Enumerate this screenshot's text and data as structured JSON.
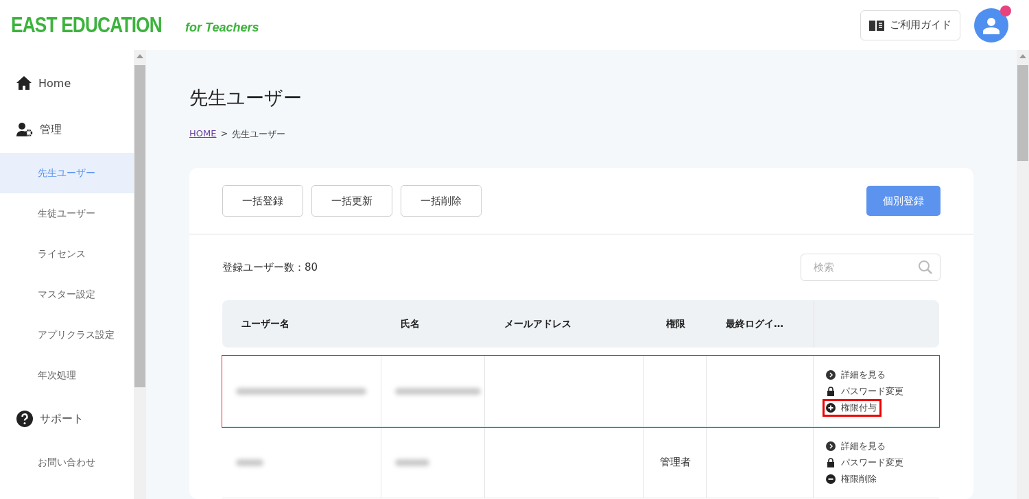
{
  "header": {
    "logo": "EAST EDUCATION",
    "logo_sub": "for Teachers",
    "guide_button": "ご利用ガイド",
    "notification": true
  },
  "sidebar": {
    "items": [
      {
        "label": "Home",
        "kind": "home",
        "selected": false
      },
      {
        "label": "管理",
        "kind": "admin",
        "selected": false,
        "children": [
          {
            "label": "先生ユーザー",
            "selected": true
          },
          {
            "label": "生徒ユーザー",
            "selected": false
          },
          {
            "label": "ライセンス",
            "selected": false
          },
          {
            "label": "マスター設定",
            "selected": false
          },
          {
            "label": "アプリクラス設定",
            "selected": false
          },
          {
            "label": "年次処理",
            "selected": false
          }
        ]
      },
      {
        "label": "サポート",
        "kind": "support",
        "selected": false,
        "children": [
          {
            "label": "お問い合わせ",
            "selected": false
          }
        ]
      }
    ]
  },
  "page": {
    "title": "先生ユーザー",
    "breadcrumb": [
      {
        "label": "HOME",
        "link": true
      },
      {
        "label": "先生ユーザー",
        "link": false
      }
    ],
    "breadcrumb_separator": ">"
  },
  "toolbar": {
    "buttons": [
      "一括登録",
      "一括更新",
      "一括削除"
    ],
    "primary_button": "個別登録"
  },
  "count_label": "登録ユーザー数：80",
  "search": {
    "placeholder": "検索"
  },
  "table": {
    "columns": [
      "ユーザー名",
      "氏名",
      "メールアドレス",
      "権限",
      "最終ログイ…"
    ],
    "rows": [
      {
        "highlighted": true,
        "redacted": [
          true,
          true
        ],
        "actions": [
          {
            "kind": "view",
            "label": "詳細を見る",
            "highlighted": false
          },
          {
            "kind": "password",
            "label": "パスワード変更",
            "highlighted": false
          },
          {
            "kind": "grant",
            "label": "権限付与",
            "highlighted": true
          }
        ]
      },
      {
        "highlighted": false,
        "redacted": [
          true,
          true
        ],
        "role": "管理者",
        "actions": [
          {
            "kind": "view",
            "label": "詳細を見る",
            "highlighted": false
          },
          {
            "kind": "password",
            "label": "パスワード変更",
            "highlighted": false
          },
          {
            "kind": "revoke",
            "label": "権限削除",
            "highlighted": false
          }
        ]
      }
    ]
  }
}
